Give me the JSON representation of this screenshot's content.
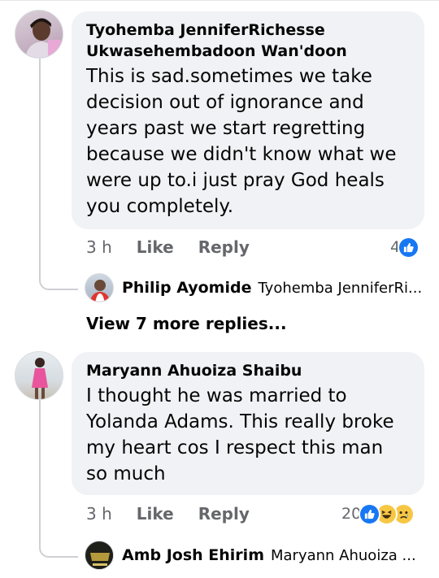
{
  "comments": [
    {
      "author_line1": "Tyohemba JenniferRichesse",
      "author_line2": "Ukwasehembadoon Wan'doon",
      "text_lines": [
        "This is sad.sometimes we take",
        "decision out of ignorance and",
        "years past we start regretting",
        "because we didn't know what we",
        "were up to.i just pray God heals",
        "you completely."
      ],
      "time": "3 h",
      "like_label": "Like",
      "reply_label": "Reply",
      "reaction_count": "4",
      "reactions": [
        "like-icon"
      ],
      "reply": {
        "author": "Philip Ayomide",
        "preview": "Tyohemba JenniferRi..."
      },
      "view_more": "View 7 more replies..."
    },
    {
      "author_line1": "Maryann Ahuoiza Shaibu",
      "text_lines": [
        "I thought he was married to",
        "Yolanda Adams. This really broke",
        "my heart cos  I respect this man",
        "so much"
      ],
      "time": "3 h",
      "like_label": "Like",
      "reply_label": "Reply",
      "reaction_count": "20",
      "reactions": [
        "like-icon",
        "haha-icon",
        "sad-icon"
      ],
      "reply": {
        "author": "Amb Josh Ehirim",
        "preview": "Maryann Ahuoiza ..."
      }
    }
  ],
  "colors": {
    "bubble": "#f0f2f5",
    "like_blue": "#1877f2",
    "secondary_text": "#65676b",
    "thread_line": "#ced0d4"
  }
}
